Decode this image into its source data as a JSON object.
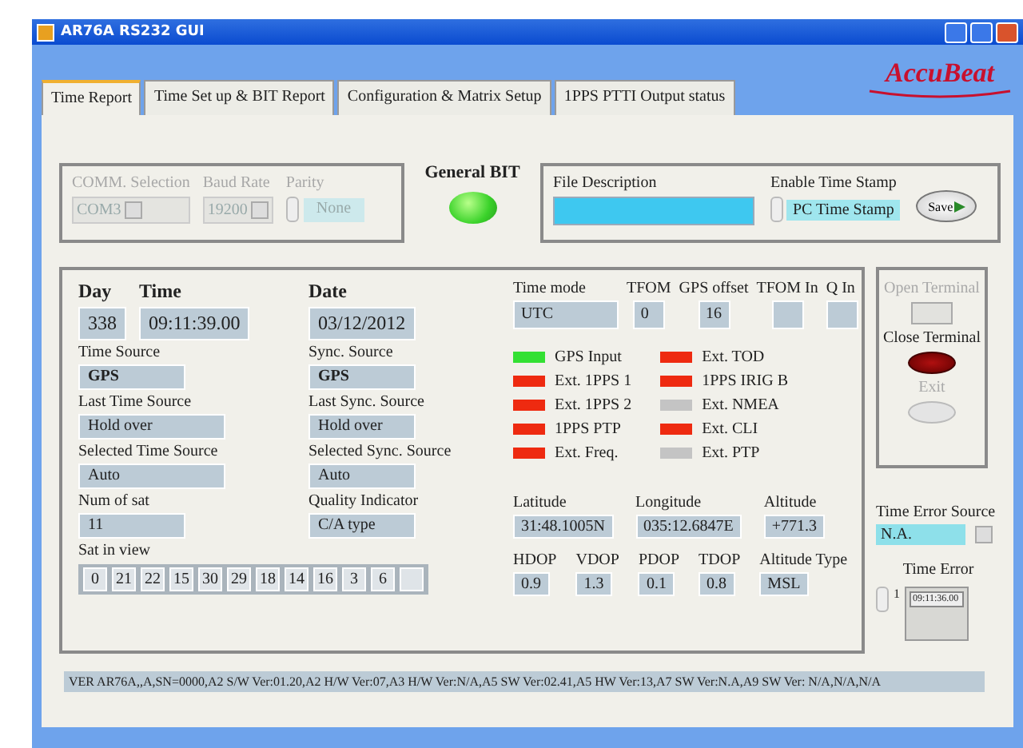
{
  "window": {
    "title": "AR76A RS232 GUI"
  },
  "logo": {
    "text": "AccuBeat"
  },
  "tabs": [
    {
      "label": "Time Report",
      "selected": true
    },
    {
      "label": "Time Set up & BIT Report",
      "selected": false
    },
    {
      "label": "Configuration & Matrix Setup",
      "selected": false
    },
    {
      "label": "1PPS PTTI Output status",
      "selected": false
    }
  ],
  "comm": {
    "disabled": true,
    "port_label": "COMM. Selection",
    "port": "COM3",
    "baud_label": "Baud Rate",
    "baud": "19200",
    "parity_label": "Parity",
    "parity": "None"
  },
  "general_bit": {
    "label": "General BIT",
    "ok": true
  },
  "file": {
    "label": "File Description",
    "timestamp_label": "Enable Time Stamp",
    "timestamp": "PC Time Stamp",
    "save": "Save"
  },
  "clock": {
    "day_label": "Day",
    "day": "338",
    "time_label": "Time",
    "time": "09:11:39.00",
    "date_label": "Date",
    "date": "03/12/2012"
  },
  "sources": [
    {
      "label": "Time Source",
      "value": "GPS",
      "bold": true
    },
    {
      "label": "Sync. Source",
      "value": "GPS",
      "bold": true
    },
    {
      "label": "Last Time Source",
      "value": "Hold over",
      "bold": false
    },
    {
      "label": "Last Sync. Source",
      "value": "Hold over",
      "bold": false
    },
    {
      "label": "Selected Time Source",
      "value": "Auto",
      "bold": false
    },
    {
      "label": "Selected Sync. Source",
      "value": "Auto",
      "bold": false
    },
    {
      "label": "Num of sat",
      "value": "11",
      "bold": false
    },
    {
      "label": "Quality Indicator",
      "value": "C/A type",
      "bold": false
    }
  ],
  "sat_in_view": {
    "label": "Sat in view",
    "values": [
      "0",
      "21",
      "22",
      "15",
      "30",
      "29",
      "18",
      "14",
      "16",
      "3",
      "6"
    ]
  },
  "mode_fields": [
    {
      "label": "Time mode",
      "value": "UTC"
    },
    {
      "label": "TFOM",
      "value": "0"
    },
    {
      "label": "GPS offset",
      "value": "16"
    },
    {
      "label": "TFOM In"
    },
    {
      "label": "Q In"
    }
  ],
  "indicators": [
    [
      {
        "label": "GPS Input",
        "color": "#33e033"
      },
      {
        "label": "Ext. 1PPS 1",
        "color": "#ee2a10"
      },
      {
        "label": "Ext. 1PPS 2",
        "color": "#ee2a10"
      },
      {
        "label": "1PPS PTP",
        "color": "#ee2a10"
      },
      {
        "label": "Ext. Freq.",
        "color": "#ee2a10"
      }
    ],
    [
      {
        "label": "Ext. TOD",
        "color": "#ee2a10"
      },
      {
        "label": "1PPS IRIG B",
        "color": "#ee2a10"
      },
      {
        "label": "Ext. NMEA",
        "color": "#c4c4c4"
      },
      {
        "label": "Ext. CLI",
        "color": "#ee2a10"
      },
      {
        "label": "Ext. PTP",
        "color": "#c4c4c4"
      }
    ]
  ],
  "position": [
    {
      "label": "Latitude",
      "value": "31:48.1005N"
    },
    {
      "label": "Longitude",
      "value": "035:12.6847E"
    },
    {
      "label": "Altitude",
      "value": "+771.3"
    }
  ],
  "dop": [
    {
      "label": "HDOP",
      "value": "0.9"
    },
    {
      "label": "VDOP",
      "value": "1.3"
    },
    {
      "label": "PDOP",
      "value": "0.1"
    },
    {
      "label": "TDOP",
      "value": "0.8"
    },
    {
      "label": "Altitude Type",
      "value": "MSL"
    }
  ],
  "terminal": [
    {
      "label": "Open Terminal",
      "kind": "rect",
      "disabled": true
    },
    {
      "label": "Close Terminal",
      "kind": "oval",
      "disabled": false
    },
    {
      "label": "Exit",
      "kind": "oval",
      "disabled": true
    }
  ],
  "time_error": {
    "source_label": "Time Error Source",
    "source": "N.A.",
    "label": "Time Error",
    "index": "1",
    "entries": [
      "09:11:36.00"
    ]
  },
  "version": "VER AR76A,,A,SN=0000,A2 S/W Ver:01.20,A2 H/W Ver:07,A3 H/W Ver:N/A,A5 SW Ver:02.41,A5 HW Ver:13,A7 SW Ver:N.A,A9 SW Ver: N/A,N/A,N/A"
}
